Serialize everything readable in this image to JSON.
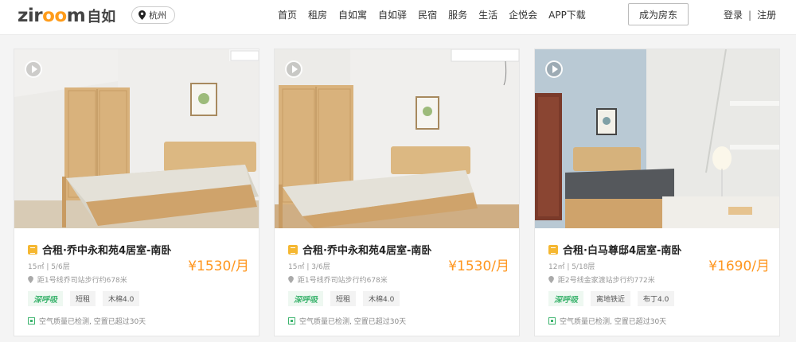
{
  "header": {
    "logo_latin_a": "zir",
    "logo_latin_b": "oo",
    "logo_latin_c": "m",
    "logo_cn": "自如",
    "city": "杭州",
    "nav": [
      "首页",
      "租房",
      "自如寓",
      "自如驿",
      "民宿",
      "服务",
      "生活",
      "企悦会",
      "APP下载"
    ],
    "owner_button": "成为房东",
    "login": "登录",
    "separator": "|",
    "register": "注册"
  },
  "listings": [
    {
      "title": "合租·乔中永和苑4居室-南卧",
      "meta": "15㎡ | 5/6层",
      "distance": "距1号线乔司站步行约678米",
      "price": "¥1530/月",
      "tags": [
        "深呼吸",
        "短租",
        "木棉4.0"
      ],
      "air": "空气质量已检测, 空置已超过30天"
    },
    {
      "title": "合租·乔中永和苑4居室-南卧",
      "meta": "15㎡ | 3/6层",
      "distance": "距1号线乔司站步行约678米",
      "price": "¥1530/月",
      "tags": [
        "深呼吸",
        "短租",
        "木棉4.0"
      ],
      "air": "空气质量已检测, 空置已超过30天"
    },
    {
      "title": "合租·白马尊邸4居室-南卧",
      "meta": "12㎡ | 5/18层",
      "distance": "距2号线金家渡站步行约772米",
      "price": "¥1690/月",
      "tags": [
        "深呼吸",
        "离地铁近",
        "布丁4.0"
      ],
      "air": "空气质量已检测, 空置已超过30天"
    }
  ],
  "colors": {
    "accent": "#ff961e",
    "green": "#3bb36d",
    "badge": "#f5b731"
  }
}
